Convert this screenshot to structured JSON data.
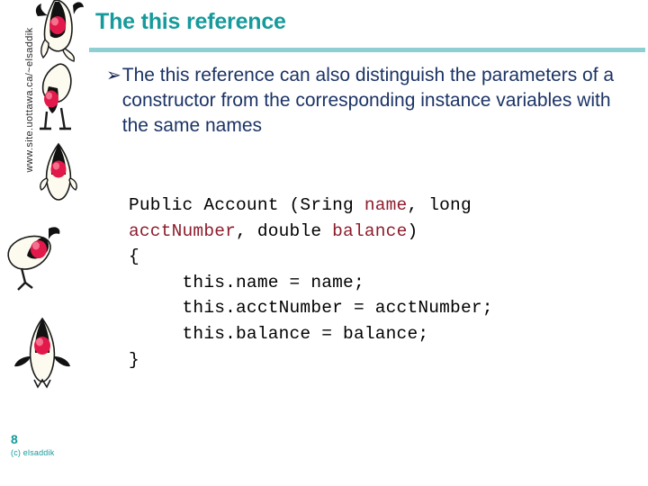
{
  "slide": {
    "title": "The this reference",
    "accent_color": "#169a9b",
    "rule_color": "#8ecfd3",
    "body_text_color": "#1b3365",
    "code_keyword_color": "#8d1c2c"
  },
  "sidebar": {
    "vertical_url": "www.site.uottawa.ca/~elsaddik",
    "mascots": [
      {
        "name": "duke-mascot-1",
        "pose": "arms-up"
      },
      {
        "name": "duke-mascot-2",
        "pose": "leaning"
      },
      {
        "name": "duke-mascot-3",
        "pose": "standing"
      },
      {
        "name": "duke-mascot-4",
        "pose": "tilted"
      },
      {
        "name": "duke-mascot-5",
        "pose": "arms-out"
      }
    ]
  },
  "bullet": {
    "marker": "➢",
    "text": "The this reference can also distinguish the parameters of a constructor from the corresponding instance variables with the same names"
  },
  "code": {
    "lines": [
      [
        {
          "t": "Public Account (Sring ",
          "k": false
        },
        {
          "t": "name",
          "k": true
        },
        {
          "t": ", long",
          "k": false
        }
      ],
      [
        {
          "t": "acctNumber",
          "k": true
        },
        {
          "t": ", double ",
          "k": false
        },
        {
          "t": "balance",
          "k": true
        },
        {
          "t": ")",
          "k": false
        }
      ],
      [
        {
          "t": "{",
          "k": false
        }
      ],
      [
        {
          "t": "     this.name = name;",
          "k": false
        }
      ],
      [
        {
          "t": "     this.acctNumber = acctNumber;",
          "k": false
        }
      ],
      [
        {
          "t": "     this.balance = balance;",
          "k": false
        }
      ],
      [
        {
          "t": "}",
          "k": false
        }
      ]
    ]
  },
  "footer": {
    "page_number": "8",
    "copyright": "(c) elsaddik"
  }
}
